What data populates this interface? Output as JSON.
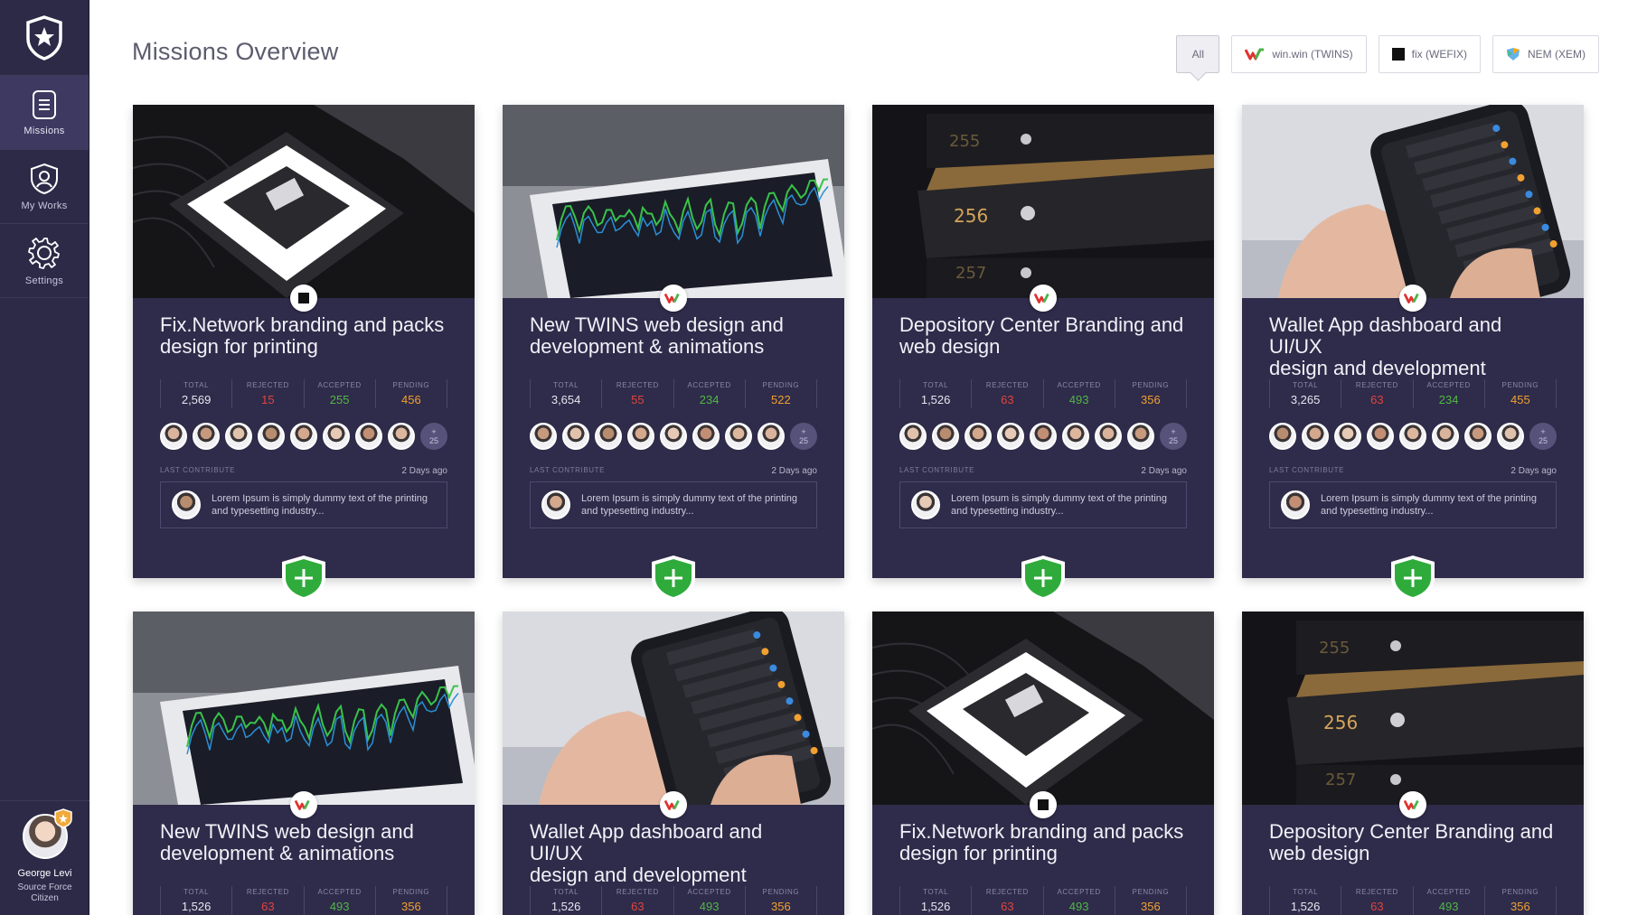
{
  "sidebar": {
    "nav": [
      {
        "label": "Missions",
        "icon": "document-icon"
      },
      {
        "label": "My Works",
        "icon": "shield-user-icon"
      },
      {
        "label": "Settings",
        "icon": "gear-icon"
      }
    ],
    "user": {
      "name": "George Levi",
      "role_line1": "Source Force",
      "role_line2": "Citizen"
    }
  },
  "header": {
    "title": "Missions Overview",
    "filters": [
      {
        "label": "All",
        "active": true
      },
      {
        "label": "win.win (TWINS)",
        "icon": "twins-logo-icon"
      },
      {
        "label": "fix (WEFIX)",
        "icon": "wefix-logo-icon"
      },
      {
        "label": "NEM (XEM)",
        "icon": "nem-logo-icon"
      }
    ]
  },
  "stat_labels": {
    "total": "TOTAL",
    "rejected": "REJECTED",
    "accepted": "ACCEPTED",
    "pending": "PENDING"
  },
  "common": {
    "last_contribute": "LAST CONTRIBUTE",
    "ago": "2 Days ago",
    "quote": "Lorem Ipsum is simply dummy text of the printing and typesetting industry...",
    "more_plus": "+",
    "more_count": "25"
  },
  "cards": [
    {
      "title_l1": "Fix.Network branding and packs",
      "title_l2": "design for printing",
      "total": "2,569",
      "rejected": "15",
      "accepted": "255",
      "pending": "456",
      "badge": "wefix"
    },
    {
      "title_l1": "New TWINS web design and",
      "title_l2": "development & animations",
      "total": "3,654",
      "rejected": "55",
      "accepted": "234",
      "pending": "522",
      "badge": "twins"
    },
    {
      "title_l1": "Depository Center Branding and",
      "title_l2": "web design",
      "total": "1,526",
      "rejected": "63",
      "accepted": "493",
      "pending": "356",
      "badge": "twins"
    },
    {
      "title_l1": "Wallet App dashboard and UI/UX",
      "title_l2": "design and development",
      "total": "3,265",
      "rejected": "63",
      "accepted": "234",
      "pending": "455",
      "badge": "twins"
    },
    {
      "title_l1": "New TWINS web design and",
      "title_l2": "development & animations",
      "total": "1,526",
      "rejected": "63",
      "accepted": "493",
      "pending": "356",
      "badge": "twins"
    },
    {
      "title_l1": "Wallet App dashboard and UI/UX",
      "title_l2": "design and development",
      "total": "1,526",
      "rejected": "63",
      "accepted": "493",
      "pending": "356",
      "badge": "twins"
    },
    {
      "title_l1": "Fix.Network branding and packs",
      "title_l2": "design for printing",
      "total": "1,526",
      "rejected": "63",
      "accepted": "493",
      "pending": "356",
      "badge": "wefix"
    },
    {
      "title_l1": "Depository Center Branding and",
      "title_l2": "web design",
      "total": "1,526",
      "rejected": "63",
      "accepted": "493",
      "pending": "356",
      "badge": "twins"
    }
  ],
  "vault_numbers": [
    "255",
    "256",
    "257"
  ],
  "colors": {
    "sidebar": "#2d2a48",
    "card": "#2f2b4a",
    "red": "#e2433d",
    "green": "#4fb845",
    "orange": "#f0a030"
  }
}
